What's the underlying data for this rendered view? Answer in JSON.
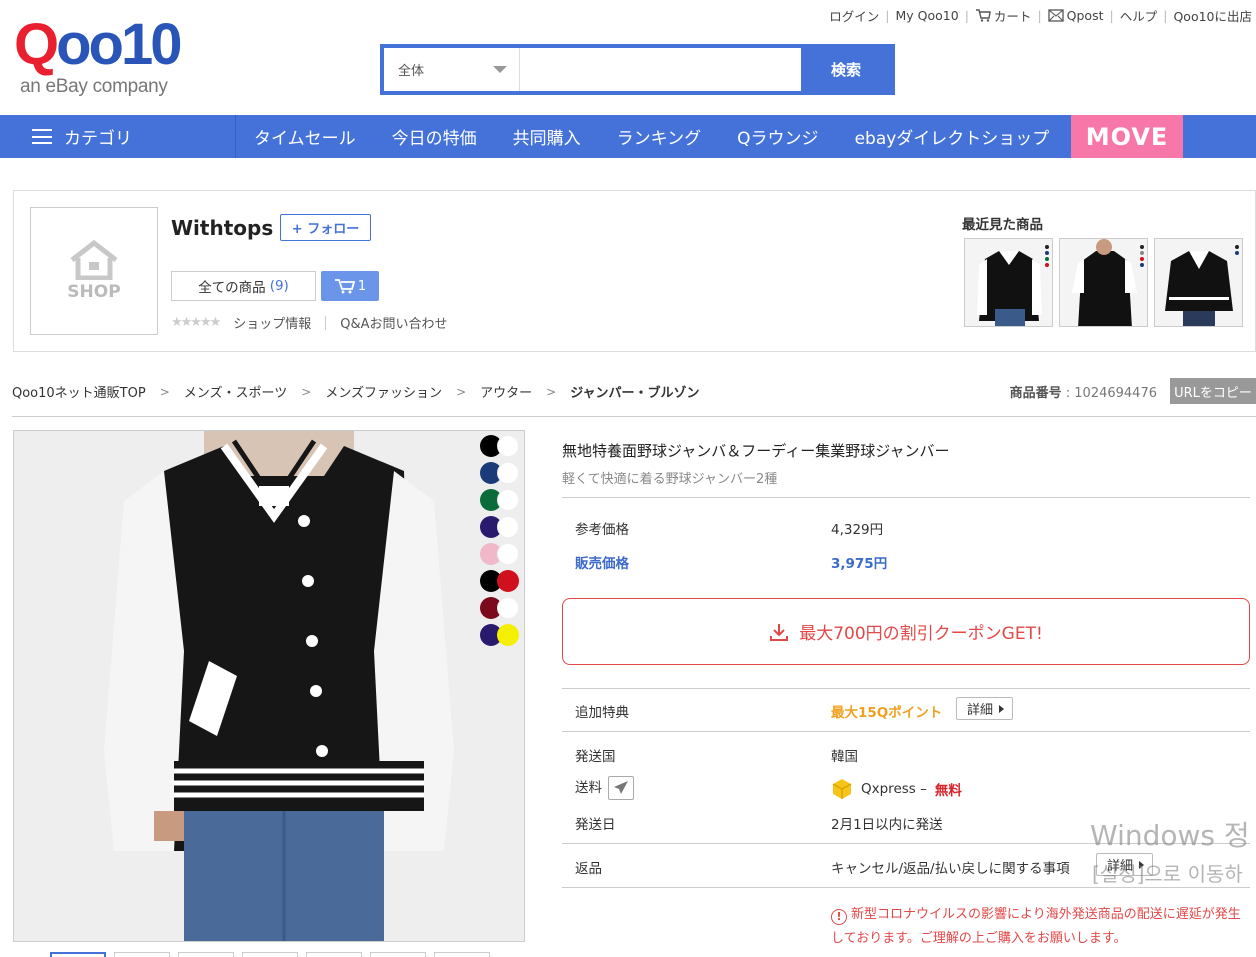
{
  "header": {
    "top_links": [
      {
        "label": "ログイン",
        "icon": ""
      },
      {
        "label": "My Qoo10",
        "icon": ""
      },
      {
        "label": "カート",
        "icon": "cart-icon"
      },
      {
        "label": "Qpost",
        "icon": "mail-icon"
      },
      {
        "label": "ヘルプ",
        "icon": ""
      },
      {
        "label": "Qoo10に出店",
        "icon": ""
      }
    ],
    "logo_text": "Qoo10",
    "logo_sub": "an eBay company"
  },
  "search": {
    "category": "全体",
    "placeholder": "",
    "button": "検索"
  },
  "nav": {
    "category_label": "カテゴリ",
    "items": [
      "タイムセール",
      "今日の特価",
      "共同購入",
      "ランキング",
      "Qラウンジ",
      "ebayダイレクトショップ"
    ],
    "move_label": "MOVE"
  },
  "shop": {
    "logo_text": "SHOP",
    "name": "Withtops",
    "follow": "+ フォロー",
    "all_items_label": "全ての商品",
    "all_items_count": "(9)",
    "cart_count": "1",
    "stars": "★★★★★",
    "shop_info": "ショップ情報",
    "qa": "Q&Aお問い合わせ",
    "recent_title": "最近見た商品"
  },
  "breadcrumb": [
    "Qoo10ネット通販TOP",
    "メンズ・スポーツ",
    "メンズファッション",
    "アウター",
    "ジャンパー・ブルゾン"
  ],
  "product_no": {
    "label": "商品番号",
    "value": ": 1024694476",
    "copy": "URLをコピー"
  },
  "swatches": [
    [
      "#000000",
      "#ffffff"
    ],
    [
      "#1b3a7a",
      "#ffffff"
    ],
    [
      "#0b6b3a",
      "#ffffff"
    ],
    [
      "#2a1a6e",
      "#ffffff"
    ],
    [
      "#f0b8c8",
      "#ffffff"
    ],
    [
      "#000000",
      "#d0101c"
    ],
    [
      "#7a0a1c",
      "#ffffff"
    ],
    [
      "#2a1a6e",
      "#f4f000"
    ]
  ],
  "product": {
    "title": "無地特養面野球ジャンバ＆フーディー集業野球ジャンバー",
    "subtitle": "軽くて快適に着る野球ジャンバー2種",
    "ref_price_label": "参考価格",
    "ref_price": "4,329円",
    "sale_price_label": "販売価格",
    "sale_price": "3,975円",
    "coupon": "最大700円の割引クーポンGET!",
    "bonus_label": "追加特典",
    "bonus_value": "最大15Qポイント",
    "detail": "詳細",
    "origin_label": "発送国",
    "origin": "韓国",
    "shipping_label": "送料",
    "shipping_carrier": "Qxpress –",
    "shipping_fee": "無料",
    "ship_date_label": "発送日",
    "ship_date": "2月1日以内に発送",
    "return_label": "返品",
    "return_value": "キャンセル/返品/払い戻しに関する事項",
    "notice": "新型コロナウイルスの影響により海外発送商品の配送に遅延が発生しております。ご理解の上ご購入をお願いします。"
  },
  "watermark": {
    "line1": "Windows 정",
    "line2": "[설정]으로 이동하"
  },
  "colors": {
    "brand_blue": "#4472d9",
    "move_pink": "#f778a8",
    "coupon_red": "#e34848",
    "point_orange": "#f0a020"
  }
}
